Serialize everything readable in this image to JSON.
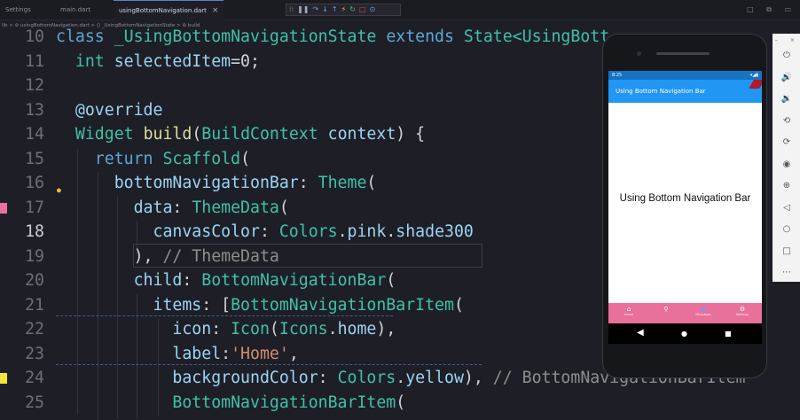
{
  "tabs": [
    {
      "label": "Settings",
      "active": false
    },
    {
      "label": "main.dart",
      "active": false
    },
    {
      "label": "usingBottomNavigation.dart",
      "active": true,
      "close": "×"
    }
  ],
  "debug_toolbar": {
    "icons": [
      "drag-handle-icon",
      "pause-icon",
      "step-over-icon",
      "step-into-icon",
      "step-out-icon",
      "hot-reload-icon",
      "restart-icon",
      "stop-icon",
      "inspect-icon"
    ],
    "glyphs": [
      "⁞⁞",
      "❚❚",
      "↷",
      "↓",
      "↑",
      "⚡",
      "↻",
      "□",
      "⊙"
    ]
  },
  "window_controls": [
    "□",
    "⧉",
    "▭"
  ],
  "breadcrumb": "lib > ⊘ usingBottomNavigation.dart > ⟨⟩ _UsingBottomNavigationState > ⊚ build",
  "code": {
    "current_line": 18,
    "lines": [
      {
        "num": "10",
        "segs": [
          {
            "t": "class ",
            "c": "k"
          },
          {
            "t": "_UsingBottomNavigationState ",
            "c": "t"
          },
          {
            "t": "extends ",
            "c": "k"
          },
          {
            "t": "State<UsingBott",
            "c": "t"
          }
        ]
      },
      {
        "num": "11",
        "segs": [
          {
            "t": "  int ",
            "c": "t"
          },
          {
            "t": "selectedItem",
            "c": "v"
          },
          {
            "t": "=0;",
            "c": "d"
          }
        ]
      },
      {
        "num": "12",
        "segs": []
      },
      {
        "num": "13",
        "segs": [
          {
            "t": "  @override",
            "c": "v"
          }
        ]
      },
      {
        "num": "14",
        "segs": [
          {
            "t": "  Widget ",
            "c": "t"
          },
          {
            "t": "build",
            "c": "f"
          },
          {
            "t": "(",
            "c": "d"
          },
          {
            "t": "BuildContext ",
            "c": "t"
          },
          {
            "t": "context",
            "c": "v"
          },
          {
            "t": ") {",
            "c": "d"
          }
        ]
      },
      {
        "num": "15",
        "segs": [
          {
            "t": "    return ",
            "c": "k"
          },
          {
            "t": "Scaffold",
            "c": "t"
          },
          {
            "t": "(",
            "c": "d"
          }
        ]
      },
      {
        "num": "16",
        "segs": [
          {
            "t": "      bottomNavigationBar",
            "c": "v"
          },
          {
            "t": ": ",
            "c": "d"
          },
          {
            "t": "Theme",
            "c": "t"
          },
          {
            "t": "(",
            "c": "d"
          }
        ]
      },
      {
        "num": "17",
        "segs": [
          {
            "t": "        data",
            "c": "v"
          },
          {
            "t": ": ",
            "c": "d"
          },
          {
            "t": "ThemeData",
            "c": "t"
          },
          {
            "t": "(",
            "c": "d"
          }
        ]
      },
      {
        "num": "18",
        "segs": [
          {
            "t": "          canvasColor",
            "c": "v"
          },
          {
            "t": ": ",
            "c": "d"
          },
          {
            "t": "Colors",
            "c": "t"
          },
          {
            "t": ".",
            "c": "d"
          },
          {
            "t": "pink",
            "c": "v"
          },
          {
            "t": ".",
            "c": "d"
          },
          {
            "t": "shade300",
            "c": "v"
          }
        ]
      },
      {
        "num": "19",
        "segs": [
          {
            "t": "        ), ",
            "c": "d"
          },
          {
            "t": "// ThemeData",
            "c": "g"
          }
        ]
      },
      {
        "num": "20",
        "segs": [
          {
            "t": "        child",
            "c": "v"
          },
          {
            "t": ": ",
            "c": "d"
          },
          {
            "t": "BottomNavigationBar",
            "c": "t"
          },
          {
            "t": "(",
            "c": "d"
          }
        ]
      },
      {
        "num": "21",
        "segs": [
          {
            "t": "          items",
            "c": "v"
          },
          {
            "t": ": [",
            "c": "d"
          },
          {
            "t": "BottomNavigationBarItem",
            "c": "t"
          },
          {
            "t": "(",
            "c": "d"
          }
        ]
      },
      {
        "num": "22",
        "segs": [
          {
            "t": "            icon",
            "c": "v"
          },
          {
            "t": ": ",
            "c": "d"
          },
          {
            "t": "Icon",
            "c": "t"
          },
          {
            "t": "(",
            "c": "d"
          },
          {
            "t": "Icons",
            "c": "t"
          },
          {
            "t": ".",
            "c": "d"
          },
          {
            "t": "home",
            "c": "v"
          },
          {
            "t": "),",
            "c": "d"
          }
        ]
      },
      {
        "num": "23",
        "segs": [
          {
            "t": "            label",
            "c": "v"
          },
          {
            "t": ":",
            "c": "d"
          },
          {
            "t": "'Home'",
            "c": "s"
          },
          {
            "t": ",",
            "c": "d"
          }
        ]
      },
      {
        "num": "24",
        "segs": [
          {
            "t": "            backgroundColor",
            "c": "v"
          },
          {
            "t": ": ",
            "c": "d"
          },
          {
            "t": "Colors",
            "c": "t"
          },
          {
            "t": ".",
            "c": "d"
          },
          {
            "t": "yellow",
            "c": "v"
          },
          {
            "t": "), ",
            "c": "d"
          },
          {
            "t": "// BottomNavigationBarItem",
            "c": "g"
          }
        ]
      },
      {
        "num": "25",
        "segs": [
          {
            "t": "            BottomNavigationBarItem",
            "c": "t"
          },
          {
            "t": "(",
            "c": "d"
          }
        ]
      }
    ]
  },
  "emulator": {
    "status_time": "8:25",
    "status_icons": "▾◢▮",
    "app_title": "Using Bottom Navigation Bar",
    "body_text": "Using Bottom Navigation Bar",
    "bottom_nav": [
      {
        "icon": "home-icon",
        "glyph": "⌂",
        "label": "Home"
      },
      {
        "icon": "person-icon",
        "glyph": "⚲",
        "label": ""
      },
      {
        "icon": "chat-icon",
        "glyph": "▬",
        "label": "Messages"
      },
      {
        "icon": "settings-icon",
        "glyph": "⚙",
        "label": "Settings"
      }
    ],
    "system_nav": [
      {
        "icon": "back-icon",
        "glyph": "◀"
      },
      {
        "icon": "home-circle-icon",
        "glyph": "●"
      },
      {
        "icon": "recents-icon",
        "glyph": "■"
      }
    ]
  },
  "emulator_toolbar": {
    "header": "– ×",
    "buttons": [
      {
        "icon": "power-icon",
        "glyph": "⏻"
      },
      {
        "icon": "volume-up-icon",
        "glyph": "🔊"
      },
      {
        "icon": "volume-down-icon",
        "glyph": "🔉"
      },
      {
        "icon": "rotate-left-icon",
        "glyph": "⟲"
      },
      {
        "icon": "rotate-right-icon",
        "glyph": "⟳"
      },
      {
        "icon": "camera-icon",
        "glyph": "◉"
      },
      {
        "icon": "zoom-icon",
        "glyph": "⊕"
      },
      {
        "icon": "back-icon",
        "glyph": "◁"
      },
      {
        "icon": "home-icon",
        "glyph": "○"
      },
      {
        "icon": "overview-icon",
        "glyph": "□"
      },
      {
        "icon": "more-icon",
        "glyph": "⋯"
      }
    ]
  }
}
